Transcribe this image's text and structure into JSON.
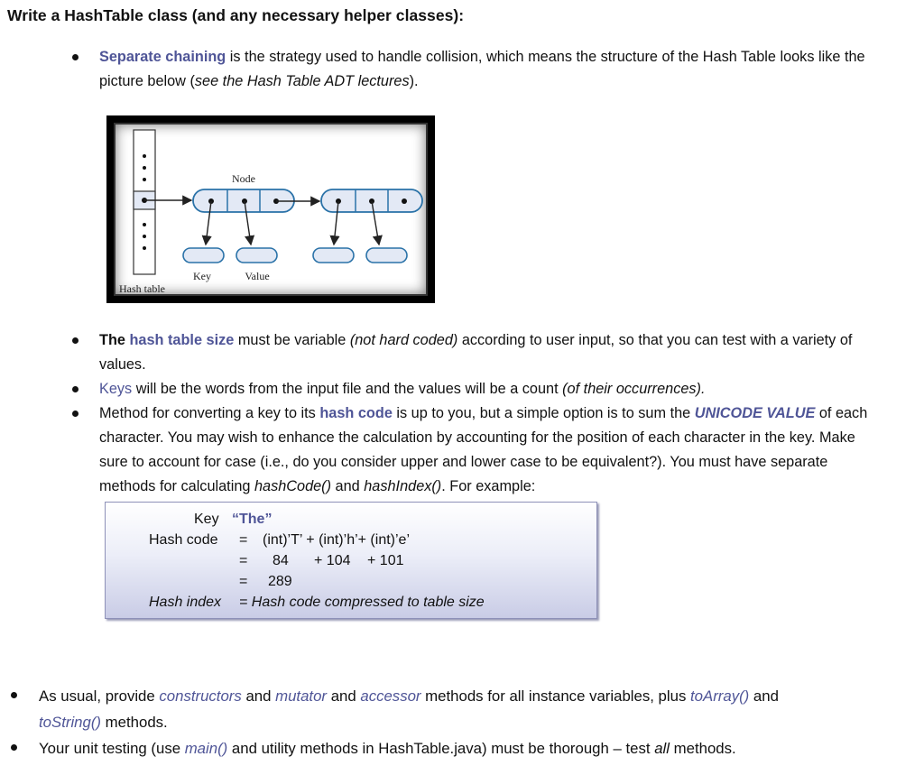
{
  "heading": "Write a HashTable class (and any necessary helper classes):",
  "colors": {
    "accent": "#4f5597",
    "text": "#111111",
    "figure_fill": "#e3e9f5",
    "figure_stroke": "#2a72a8"
  },
  "bullets": {
    "separate_chaining": {
      "lead": "Separate chaining",
      "line1_rest": " is the strategy used to handle collision, which means the structure of the Hash Table looks like the",
      "line2_start": "picture below (",
      "line2_italic": "see the Hash Table ADT lectures",
      "line2_end": ")."
    },
    "table_size": {
      "lead_bold": "The ",
      "accent_bold": "hash table size",
      "mid": " must be variable ",
      "italic": "(not hard coded)",
      "rest": " according to user input, so that you can test with a variety of",
      "line2": "values."
    },
    "keys": {
      "accent": "Keys",
      "rest": " will be the words from the input file and the values will be a count ",
      "italic": "(of their occurrences)."
    },
    "method": {
      "line1_start": "Method for converting a key to its ",
      "line1_accent": "hash code",
      "line1_mid": " is up to you, but a simple option is to sum the ",
      "line1_accent2": "UNICODE VALUE",
      "line1_end": " of each",
      "line2": "character.  You may wish to enhance the calculation by accounting for the position of each character in the key.  Make",
      "line3": "sure to account for case (i.e., do you consider upper and lower case to be equivalent?).  You must have separate",
      "line4_start": "methods for calculating ",
      "line4_i1": "hashCode()",
      "line4_mid": " and ",
      "line4_i2": "hashIndex()",
      "line4_end": ".  For example:"
    },
    "usual": {
      "start": "As usual, provide ",
      "i1": "constructors",
      "and1": " and ",
      "i2": "mutator",
      "and2": " and ",
      "i3": "accessor",
      "mid": " methods for all instance variables, plus ",
      "i4": "toArray()",
      "end": " and",
      "line2_i": "toString()",
      "line2_end": " methods."
    },
    "testing": {
      "start": "Your unit testing (use ",
      "i1": "main()",
      "mid": " and utility methods in HashTable.java) must be thorough – test ",
      "i2": "all",
      "end": " methods."
    }
  },
  "figure": {
    "node_label": "Node",
    "key_label": "Key",
    "value_label": "Value",
    "table_label": "Hash table"
  },
  "example": {
    "key_label": "Key",
    "key_value": "“The”",
    "hash_code_label": "Hash code",
    "eq": "=",
    "row1": "(int)’T’ + (int)’h’+  (int)’e’",
    "row2_a": "84",
    "row2_b": "+ 104",
    "row2_c": "+  101",
    "row3": "289",
    "hash_index_label": "Hash index",
    "row4": "=  Hash code compressed to table size"
  }
}
